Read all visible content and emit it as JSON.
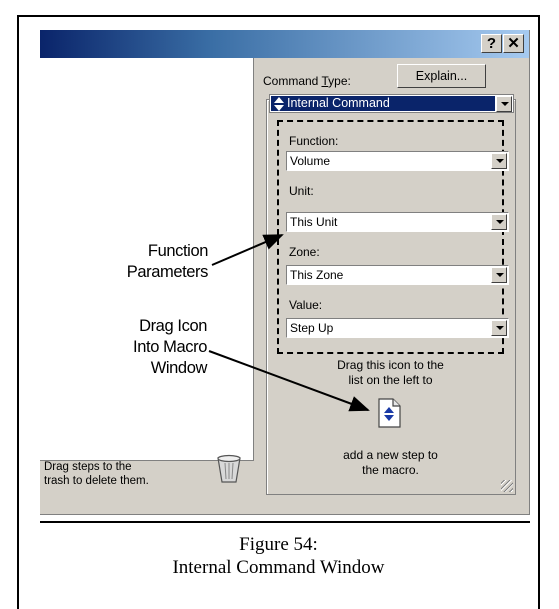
{
  "window": {
    "help_button": "?",
    "close_button": "✕"
  },
  "left_pane": {
    "trash_hint_line1": "Drag steps to the",
    "trash_hint_line2": "trash to delete them."
  },
  "command": {
    "label_prefix": "Command ",
    "label_accel": "T",
    "label_suffix": "ype:",
    "explain_button": "Explain...",
    "type_value": "Internal Command"
  },
  "params": {
    "function_label": "Function:",
    "function_value": "Volume",
    "unit_label": "Unit:",
    "unit_value": "This Unit",
    "zone_label": "Zone:",
    "zone_value": "This Zone",
    "value_label": "Value:",
    "value_value": "Step Up"
  },
  "drag_hint": {
    "line1": "Drag this icon to the",
    "line2": "list on the left to",
    "line3": "add a new step to",
    "line4": "the macro."
  },
  "annotations": {
    "function_params_line1": "Function",
    "function_params_line2": "Parameters",
    "drag_icon_line1": "Drag Icon",
    "drag_icon_line2": "Into Macro",
    "drag_icon_line3": "Window"
  },
  "caption": {
    "line1": "Figure 54:",
    "line2": "Internal Command Window"
  },
  "icons": {
    "title_help": "help-icon",
    "title_close": "close-icon",
    "trash": "trash-icon",
    "command_type": "internal-command-icon",
    "drag_step": "new-step-document-icon"
  },
  "colors": {
    "titlebar_start": "#0a246a",
    "titlebar_end": "#a6caf0",
    "selection": "#0a246a",
    "window_face": "#d4d0c8"
  }
}
